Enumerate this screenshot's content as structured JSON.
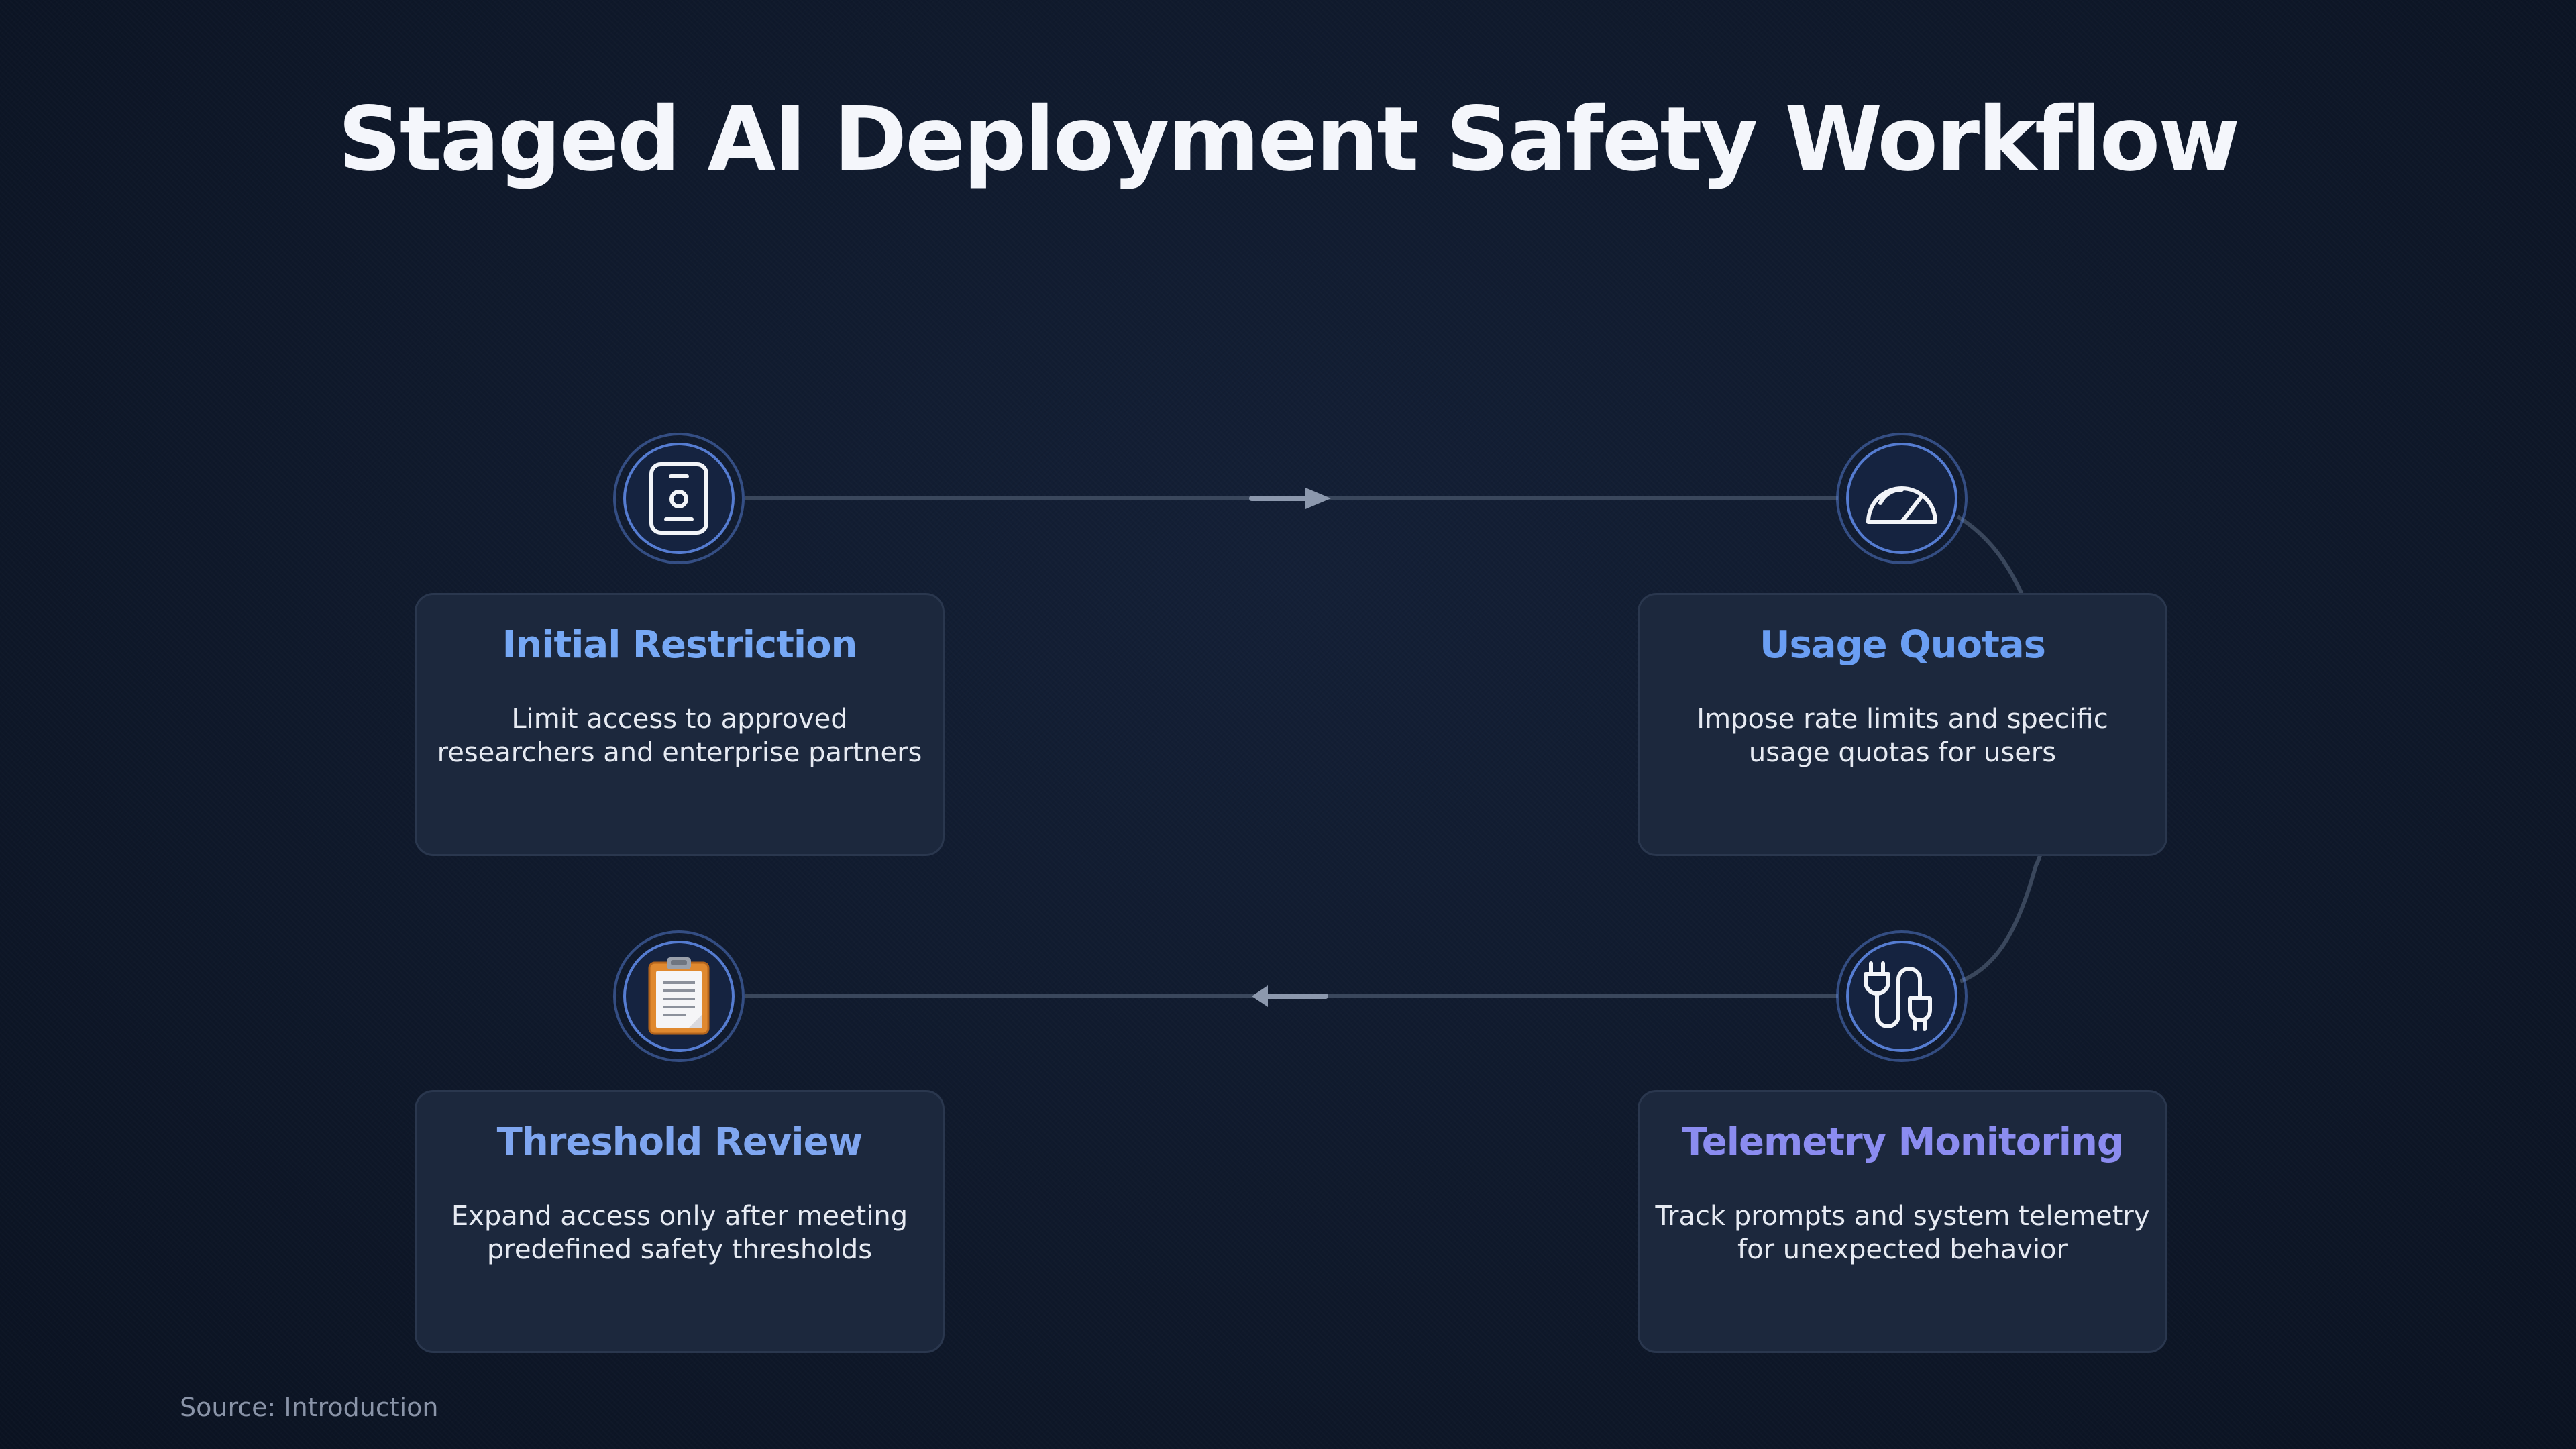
{
  "title": "Staged AI Deployment Safety Workflow",
  "source": "Source: Introduction",
  "colors": {
    "background": "#101a2c",
    "card": "#1c283d",
    "ring": "#608ceb",
    "title_blue": "#76a8f5",
    "title_indigo": "#8b8cf0",
    "connector": "#3a475c"
  },
  "steps": [
    {
      "title": "Initial Restriction",
      "description": "Limit access to approved researchers and enterprise partners",
      "icon": "id-badge-icon"
    },
    {
      "title": "Usage Quotas",
      "description": "Impose rate limits and specific usage quotas for users",
      "icon": "speedometer-icon"
    },
    {
      "title": "Telemetry Monitoring",
      "description": "Track prompts and system telemetry for unexpected behavior",
      "icon": "plug-cable-icon"
    },
    {
      "title": "Threshold Review",
      "description": "Expand access only after meeting predefined safety thresholds",
      "icon": "clipboard-icon"
    }
  ]
}
